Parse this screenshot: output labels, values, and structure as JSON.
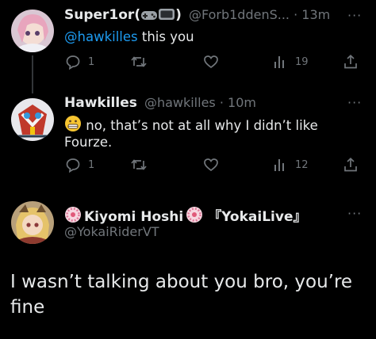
{
  "tweets": [
    {
      "display_name": "Super1or(",
      "display_name_suffix": ")",
      "handle": "@Forb1ddenS...",
      "time": "· 13m",
      "mention": "@hawkilles",
      "text": " this you",
      "reply_count": "1",
      "views_count": "19"
    },
    {
      "display_name": "Hawkilles",
      "handle": "@hawkilles",
      "time": "· 10m",
      "text_line1": " no, that’s not at all why I didn’t like",
      "text_line2": "Fourze.",
      "reply_count": "1",
      "views_count": "12"
    }
  ],
  "quoted": {
    "display_name": "Kiyomi Hoshi",
    "tag": "『YokaiLive』",
    "handle": "@YokaiRiderVT",
    "text": "I wasn’t talking about you bro, you’re fine"
  },
  "colors": {
    "background": "#000000",
    "text": "#e7e9ea",
    "muted": "#71767b",
    "link": "#1d9bf0",
    "divider": "#333639"
  },
  "icons": [
    "more-icon",
    "reply-icon",
    "retweet-icon",
    "like-icon",
    "views-icon",
    "share-icon",
    "gamepad-emoji",
    "tv-emoji",
    "grimace-emoji",
    "sakura-emoji"
  ]
}
